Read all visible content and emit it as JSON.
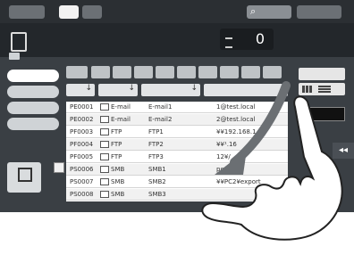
{
  "counter": {
    "value": "0"
  },
  "list": {
    "rows": [
      {
        "num": "PE0001",
        "type": "E-mail",
        "name": "E-mail1",
        "dest": "1@test.local",
        "icon": "email-icon"
      },
      {
        "num": "PE0002",
        "type": "E-mail",
        "name": "E-mail2",
        "dest": "2@test.local",
        "icon": "email-icon"
      },
      {
        "num": "PF0003",
        "type": "FTP",
        "name": "FTP1",
        "dest": "¥¥192.168.1.1",
        "icon": "ftp-icon"
      },
      {
        "num": "PF0004",
        "type": "FTP",
        "name": "FTP2",
        "dest": "¥¥¹.16",
        "icon": "ftp-icon"
      },
      {
        "num": "PF0005",
        "type": "FTP",
        "name": "FTP3",
        "dest": "12¥/",
        "icon": "ftp-icon"
      },
      {
        "num": "PS0006",
        "type": "SMB",
        "name": "SMB1",
        "dest": "port",
        "icon": "smb-icon"
      },
      {
        "num": "PS0007",
        "type": "SMB",
        "name": "SMB2",
        "dest": "¥¥PC2¥export",
        "icon": "smb-icon"
      },
      {
        "num": "PS0008",
        "type": "SMB",
        "name": "SMB3",
        "dest": "",
        "icon": "smb-icon"
      }
    ]
  },
  "side_tab": {
    "label": "◂◂"
  },
  "colors": {
    "panel": "#3a3f44",
    "list_bg": "#ffffff",
    "arrow": "#555555"
  }
}
